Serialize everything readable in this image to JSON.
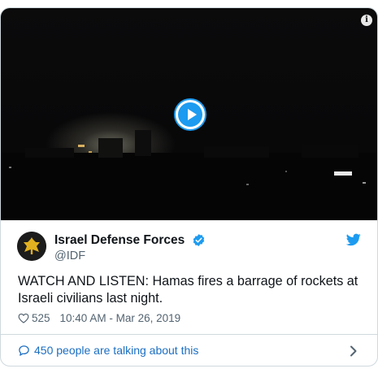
{
  "video": {
    "play_icon": "play-icon",
    "info_icon": "info-icon",
    "info_glyph": "i"
  },
  "author": {
    "name": "Israel Defense Forces",
    "handle": "@IDF",
    "verified": true,
    "avatar_icon": "idf-emblem"
  },
  "tweet": {
    "text": "WATCH AND LISTEN: Hamas fires a barrage of rockets at Israeli civilians last night.",
    "likes": "525",
    "timestamp": "10:40 AM - Mar 26, 2019"
  },
  "footer": {
    "talking_label": "450 people are talking about this"
  },
  "colors": {
    "accent": "#1d9bf0",
    "link": "#1b6ec2",
    "text": "#0f1419",
    "secondary": "#536471",
    "border": "#cfd9de"
  }
}
